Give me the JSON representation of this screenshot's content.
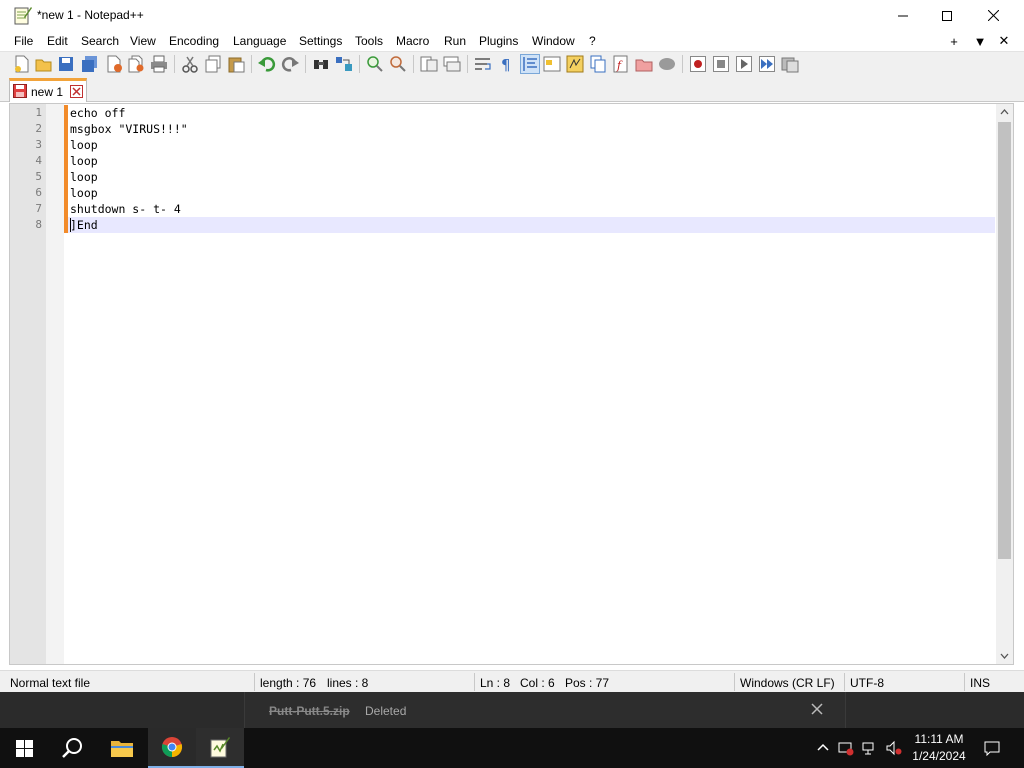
{
  "window": {
    "title": "*new 1 - Notepad++",
    "menu": [
      "File",
      "Edit",
      "Search",
      "View",
      "Encoding",
      "Language",
      "Settings",
      "Tools",
      "Macro",
      "Run",
      "Plugins",
      "Window",
      "?"
    ],
    "menu_right": [
      "+",
      "▼",
      "✕"
    ]
  },
  "tabs": [
    {
      "label": "new 1",
      "active": true,
      "modified": true
    }
  ],
  "editor": {
    "line_numbers": [
      "1",
      "2",
      "3",
      "4",
      "5",
      "6",
      "7",
      "8"
    ],
    "lines": [
      "echo off",
      "msgbox \"VIRUS!!!\"",
      "loop",
      "loop",
      "loop",
      "loop",
      "shutdown s- t- 4",
      "]End"
    ],
    "current_line": 8
  },
  "status": {
    "file_type": "Normal text file",
    "length": "length : 76",
    "lines": "lines : 8",
    "ln": "Ln : 8",
    "col": "Col : 6",
    "pos": "Pos : 77",
    "eol": "Windows (CR LF)",
    "encoding": "UTF-8",
    "mode": "INS"
  },
  "notification": {
    "file": "Putt-Putt.5.zip",
    "status": "Deleted"
  },
  "taskbar": {
    "time": "11:11 AM",
    "date": "1/24/2024"
  },
  "colors": {
    "accent_orange": "#f28b2a",
    "current_line_bg": "#e8e8ff",
    "taskbar_bg": "#101010",
    "tab_top_border": "#f2a33a"
  }
}
